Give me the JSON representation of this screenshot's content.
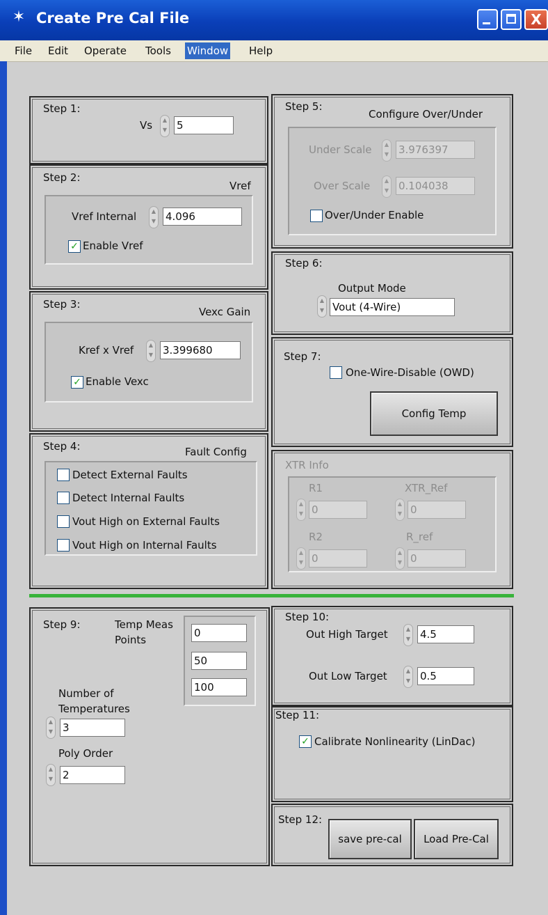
{
  "window": {
    "title": "Create Pre Cal File",
    "icon": "ti-logo-icon",
    "close_glyph": "X"
  },
  "menu": [
    "File",
    "Edit",
    "Operate",
    "Tools",
    "Window",
    "Help"
  ],
  "step1": {
    "label": "Step 1:",
    "vs_label": "Vs",
    "vs_value": "5"
  },
  "step2": {
    "label": "Step 2:",
    "title": "Vref",
    "vref_label": "Vref Internal",
    "vref_value": "4.096",
    "enable_label": "Enable Vref",
    "enable_checked": true
  },
  "step3": {
    "label": "Step 3:",
    "title": "Vexc Gain",
    "kref_label": "Kref x Vref",
    "kref_value": "3.399680",
    "enable_label": "Enable Vexc",
    "enable_checked": true
  },
  "step4": {
    "label": "Step 4:",
    "title": "Fault Config",
    "options": [
      "Detect External Faults",
      "Detect Internal Faults",
      "Vout High on External Faults",
      "Vout High on Internal Faults"
    ]
  },
  "step5": {
    "label": "Step 5:",
    "title": "Configure Over/Under",
    "under_label": "Under Scale",
    "under_value": "3.976397",
    "over_label": "Over Scale",
    "over_value": "0.104038",
    "enable_label": "Over/Under Enable"
  },
  "step6": {
    "label": "Step 6:",
    "mode_label": "Output Mode",
    "mode_value": "Vout (4-Wire)"
  },
  "step7": {
    "label": "Step 7:",
    "owd_label": "One-Wire-Disable (OWD)",
    "button": "Config Temp"
  },
  "xtr": {
    "label": "XTR Info",
    "r1_label": "R1",
    "r1_value": "0",
    "xtr_ref_label": "XTR_Ref",
    "xtr_ref_value": "0",
    "r2_label": "R2",
    "r2_value": "0",
    "r_ref_label": "R_ref",
    "r_ref_value": "0"
  },
  "step9": {
    "label": "Step 9:",
    "temp_points_label_1": "Temp Meas",
    "temp_points_label_2": "Points",
    "temp_points": [
      "0",
      "50",
      "100"
    ],
    "num_temps_label_1": "Number of",
    "num_temps_label_2": "Temperatures",
    "num_temps_value": "3",
    "poly_label": "Poly Order",
    "poly_value": "2"
  },
  "step10": {
    "label": "Step 10:",
    "high_label": "Out High Target",
    "high_value": "4.5",
    "low_label": "Out Low Target",
    "low_value": "0.5"
  },
  "step11": {
    "label": "Step 11:",
    "cal_label": "Calibrate Nonlinearity (LinDac)",
    "cal_checked": true
  },
  "step12": {
    "label": "Step 12:",
    "save_button": "save pre-cal",
    "load_button": "Load Pre-Cal"
  },
  "colors": {
    "titlebar": "#0a3fb8",
    "divider": "#39b33b",
    "check": "#21a121"
  }
}
